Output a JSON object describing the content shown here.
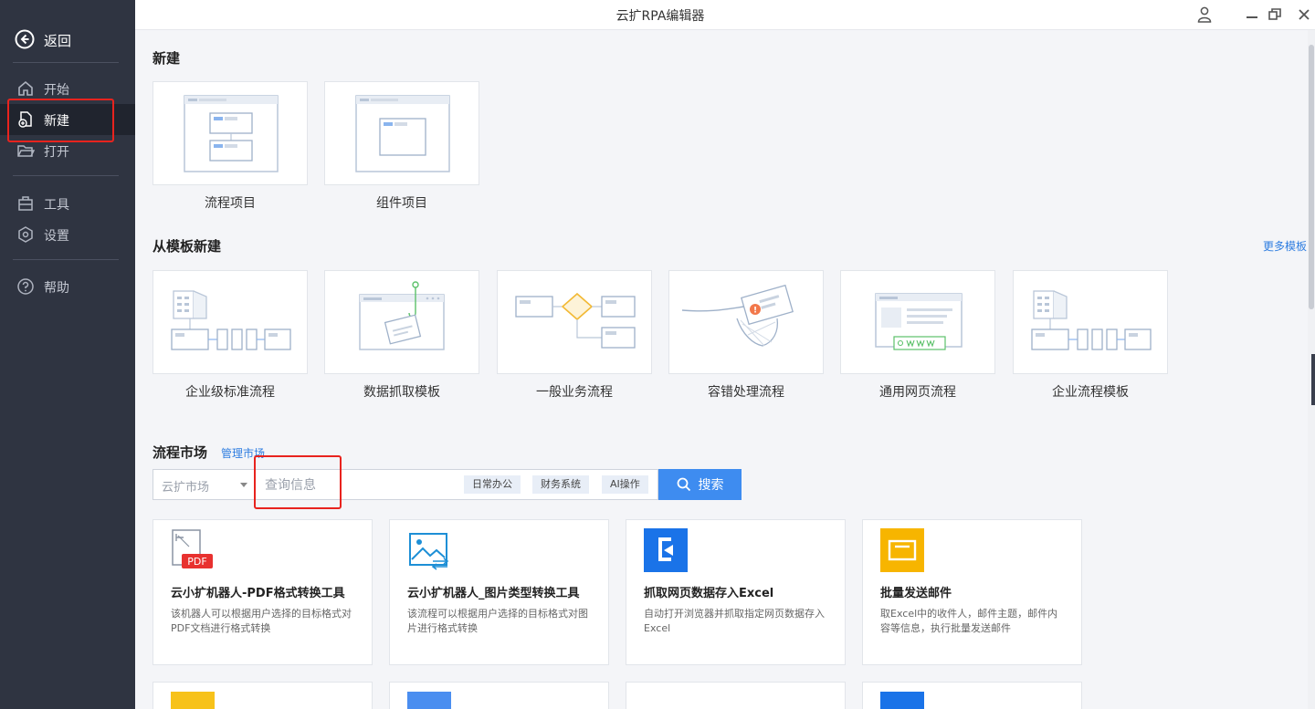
{
  "window": {
    "title": "云扩RPA编辑器"
  },
  "sidebar": {
    "back_label": "返回",
    "items": [
      {
        "label": "开始",
        "icon": "home-icon"
      },
      {
        "label": "新建",
        "icon": "new-file-icon"
      },
      {
        "label": "打开",
        "icon": "folder-open-icon"
      },
      {
        "label": "工具",
        "icon": "toolbox-icon"
      },
      {
        "label": "设置",
        "icon": "gear-icon"
      },
      {
        "label": "帮助",
        "icon": "help-icon"
      }
    ],
    "active": "新建"
  },
  "new_section": {
    "title": "新建",
    "cards": [
      {
        "label": "流程项目"
      },
      {
        "label": "组件项目"
      }
    ]
  },
  "template_section": {
    "title": "从模板新建",
    "more_link": "更多模板",
    "cards": [
      {
        "label": "企业级标准流程"
      },
      {
        "label": "数据抓取模板"
      },
      {
        "label": "一般业务流程"
      },
      {
        "label": "容错处理流程"
      },
      {
        "label": "通用网页流程"
      },
      {
        "label": "企业流程模板"
      }
    ]
  },
  "market_section": {
    "title": "流程市场",
    "manage_link": "管理市场",
    "search": {
      "market_value": "云扩市场",
      "placeholder": "查询信息",
      "tags": [
        "日常办公",
        "财务系统",
        "AI操作"
      ],
      "button_label": "搜索"
    },
    "cards": [
      {
        "title": "云小扩机器人-PDF格式转换工具",
        "desc": "该机器人可以根据用户选择的目标格式对PDF文档进行格式转换",
        "icon": "pdf-icon",
        "badge": "PDF"
      },
      {
        "title": "云小扩机器人_图片类型转换工具",
        "desc": "该流程可以根据用户选择的目标格式对图片进行格式转换",
        "icon": "image-convert-icon"
      },
      {
        "title": "抓取网页数据存入Excel",
        "desc": "自动打开浏览器并抓取指定网页数据存入Excel",
        "icon": "browser-logo-icon"
      },
      {
        "title": "批量发送邮件",
        "desc": "取Excel中的收件人，邮件主题，邮件内容等信息，执行批量发送邮件",
        "icon": "mail-icon"
      }
    ]
  },
  "colors": {
    "sidebar_bg": "#2f3441",
    "accent": "#3e8cf0",
    "highlight": "#e8231e"
  }
}
